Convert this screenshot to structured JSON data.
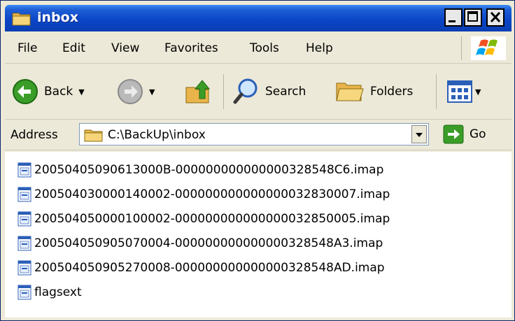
{
  "window": {
    "title": "inbox"
  },
  "menu": [
    "File",
    "Edit",
    "View",
    "Favorites",
    "Tools",
    "Help"
  ],
  "toolbar": {
    "back": "Back",
    "search": "Search",
    "folders": "Folders"
  },
  "address": {
    "label": "Address",
    "path": "C:\\BackUp\\inbox",
    "go": "Go"
  },
  "files": [
    "20050405090613000B-000000000000000328548C6.imap",
    "200504030000140002-000000000000000032830007.imap",
    "200504050000100002-000000000000000032850005.imap",
    "200504050905070004-000000000000000328548A3.imap",
    "200504050905270008-000000000000000328548AD.imap",
    "flagsext"
  ],
  "colors": {
    "titlebar": "#0b46c8",
    "chrome": "#ece9d8",
    "content": "#ffffff"
  }
}
